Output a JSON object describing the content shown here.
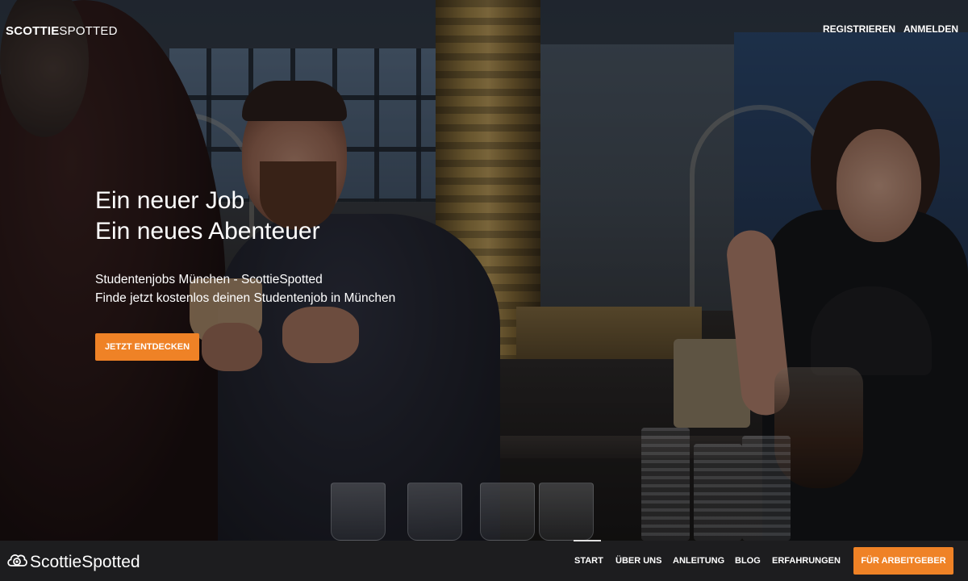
{
  "brand": {
    "bold": "SCOTTIE",
    "regular": "SPOTTED"
  },
  "top_nav": {
    "register": "REGISTRIEREN",
    "login": "ANMELDEN"
  },
  "hero": {
    "headline_line1": "Ein neuer Job",
    "headline_line2": "Ein neues Abenteuer",
    "sub_line1": "Studentenjobs München - ScottieSpotted",
    "sub_line2": "Finde jetzt kostenlos deinen Studentenjob in München",
    "cta_label": "JETZT ENTDECKEN"
  },
  "bottom_bar": {
    "logo_text": "ScottieSpotted",
    "nav": [
      "START",
      "ÜBER UNS",
      "ANLEITUNG",
      "BLOG",
      "ERFAHRUNGEN"
    ],
    "employer_label": "FÜR ARBEITGEBER"
  },
  "colors": {
    "accent": "#ef8226",
    "bar": "#1d1d1f"
  },
  "icons": {
    "logo": "cloud-camera-icon"
  }
}
